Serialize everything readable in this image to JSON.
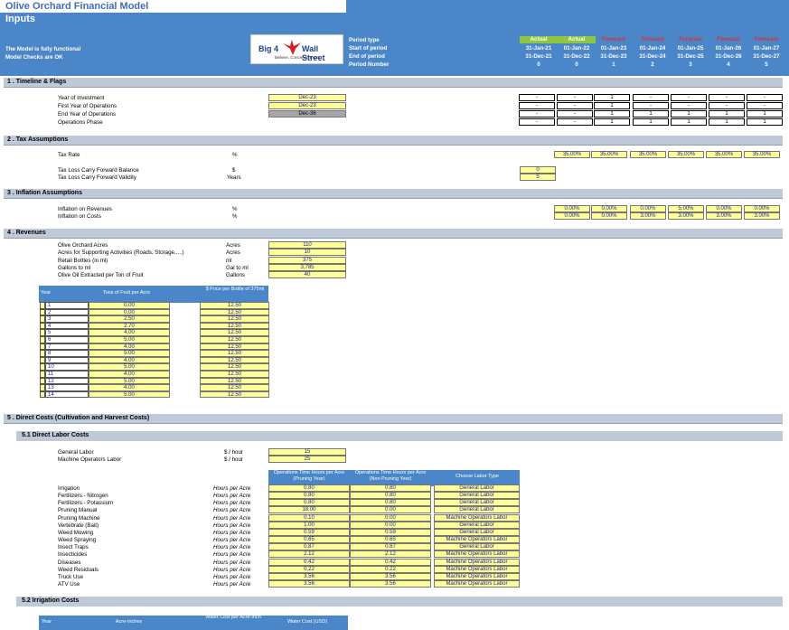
{
  "header": {
    "title": "Olive Orchard Financial Model",
    "subtitle": "Inputs",
    "status1": "The Model is fully functional",
    "status2": "Model Checks are OK",
    "logo_big": "Big 4",
    "logo_wall": "Wall Street",
    "logo_tag": "Believe, Conceive, Excel",
    "labels": [
      "Period type",
      "Start of period",
      "End of period",
      "Period Number"
    ],
    "periods": [
      {
        "type": "Actual",
        "start": "31-Jan-21",
        "end": "31-Dec-21",
        "num": "0"
      },
      {
        "type": "Actual",
        "start": "01-Jan-22",
        "end": "31-Dec-22",
        "num": "0"
      },
      {
        "type": "Forecast",
        "start": "01-Jan-23",
        "end": "31-Dec-23",
        "num": "1"
      },
      {
        "type": "Forecast",
        "start": "01-Jan-24",
        "end": "31-Dec-24",
        "num": "2"
      },
      {
        "type": "Forecast",
        "start": "01-Jan-25",
        "end": "31-Dec-25",
        "num": "3"
      },
      {
        "type": "Forecast",
        "start": "01-Jan-26",
        "end": "31-Dec-26",
        "num": "4"
      },
      {
        "type": "Forecast",
        "start": "01-Jan-27",
        "end": "31-Dec-27",
        "num": "5"
      }
    ]
  },
  "s1": {
    "title": "1 .  Timeline & Flags",
    "rows": [
      {
        "label": "Year of Investment",
        "value": "Dec-23",
        "flags": [
          "-",
          "-",
          "1",
          "-",
          "-",
          "-",
          "-"
        ]
      },
      {
        "label": "First Year of Operations",
        "value": "Dec-23",
        "flags": [
          "-",
          "-",
          "1",
          "-",
          "-",
          "-",
          "-"
        ]
      },
      {
        "label": "End Year of Operations",
        "value": "Dec-36",
        "flags": [
          "-",
          "-",
          "1",
          "1",
          "1",
          "1",
          "1"
        ]
      },
      {
        "label": "Operations Phase",
        "value": "",
        "flags": [
          "-",
          "-",
          "1",
          "1",
          "1",
          "1",
          "1"
        ]
      }
    ]
  },
  "s2": {
    "title": "2 .  Tax Assumptions",
    "tax_label": "Tax Rate",
    "tax_unit": "%",
    "tax_rates": [
      "35.00%",
      "35.00%",
      "35.00%",
      "35.00%",
      "35.00%",
      "35.00%"
    ],
    "tlcf_label": "Tax Loss Carry Forward Balance",
    "tlcf_unit": "$",
    "tlcf_value": "0",
    "tlcv_label": "Tax Loss Carry Forward Validity",
    "tlcv_unit": "Years",
    "tlcv_value": "5"
  },
  "s3": {
    "title": "3 .  Inflation Assumptions",
    "rev_label": "Inflation on Revenues",
    "rev_unit": "%",
    "rev": [
      "0.00%",
      "0.00%",
      "0.00%",
      "5.00%",
      "0.00%",
      "0.00%"
    ],
    "cost_label": "Inflation on Costs",
    "cost_unit": "%",
    "cost": [
      "0.00%",
      "0.00%",
      "3.00%",
      "3.00%",
      "3.00%",
      "3.00%"
    ]
  },
  "s4": {
    "title": "4 .  Revenues",
    "params": [
      {
        "label": "Olive Orchard Acres",
        "unit": "Acres",
        "value": "110"
      },
      {
        "label": "Acres for Supporting Activities (Roads, Storage,....)",
        "unit": "Acres",
        "value": "10"
      },
      {
        "label": "Retail Bottles (in ml)",
        "unit": "ml",
        "value": "375"
      },
      {
        "label": "Gallons to ml",
        "unit": "Gal to ml",
        "value": "3,785"
      },
      {
        "label": "Olive Oil Extracted per Ton of Fruit",
        "unit": "Gallons",
        "value": "40"
      }
    ],
    "table_headers": [
      "Year",
      "Tons of Fruit per Acre",
      "$ Price per Bottle of 375ml"
    ],
    "table": [
      [
        "1",
        "0.00",
        "12.50"
      ],
      [
        "2",
        "0.00",
        "12.50"
      ],
      [
        "3",
        "2.50",
        "12.50"
      ],
      [
        "4",
        "2.70",
        "12.50"
      ],
      [
        "5",
        "4.00",
        "12.50"
      ],
      [
        "6",
        "5.00",
        "12.50"
      ],
      [
        "7",
        "4.00",
        "12.50"
      ],
      [
        "8",
        "5.00",
        "12.50"
      ],
      [
        "9",
        "4.00",
        "12.50"
      ],
      [
        "10",
        "5.00",
        "12.50"
      ],
      [
        "11",
        "4.00",
        "12.50"
      ],
      [
        "12",
        "5.00",
        "12.50"
      ],
      [
        "13",
        "4.00",
        "12.50"
      ],
      [
        "14",
        "5.00",
        "12.50"
      ]
    ]
  },
  "s5": {
    "title": "5 .  Direct Costs (Cultivation and Harvest Costs)",
    "sub1": "5.1    Direct Labor Costs",
    "labor": [
      {
        "label": "General Labor",
        "unit": "$ / hour",
        "value": "15"
      },
      {
        "label": "Machine Operators Labor",
        "unit": "$ / hour",
        "value": "25"
      }
    ],
    "op_headers": [
      "Operations Time Hours per Acre (Pruning Year)",
      "Operations Time Hours per Acre (Non Pruning Year)",
      "Choose Labor Type"
    ],
    "ops": [
      [
        "Irrigation",
        "Hours per Acre",
        "0.80",
        "0.80",
        "General Labor"
      ],
      [
        "Fertilizers - Nitrogen",
        "Hours per Acre",
        "0.80",
        "0.80",
        "General Labor"
      ],
      [
        "Fertilizers - Potassium",
        "Hours per Acre",
        "0.80",
        "0.80",
        "General Labor"
      ],
      [
        "Pruning Manual",
        "Hours per Acre",
        "18.00",
        "0.00",
        "General Labor"
      ],
      [
        "Pruning Machine",
        "Hours per Acre",
        "0.10",
        "0.00",
        "Machine Operators Labor"
      ],
      [
        "Vertebrate (Bait)",
        "Hours per Acre",
        "1.00",
        "0.00",
        "General Labor"
      ],
      [
        "Weed Mowing",
        "Hours per Acre",
        "0.59",
        "0.59",
        "General Labor"
      ],
      [
        "Weed Spraying",
        "Hours per Acre",
        "0.65",
        "0.65",
        "Machine Operators Labor"
      ],
      [
        "Insect Traps",
        "Hours per Acre",
        "0.87",
        "0.87",
        "General Labor"
      ],
      [
        "Insecticides",
        "Hours per Acre",
        "2.12",
        "2.12",
        "Machine Operators Labor"
      ],
      [
        "Diseases",
        "Hours per Acre",
        "0.42",
        "0.42",
        "Machine Operators Labor"
      ],
      [
        "Weed Residuals",
        "Hours per Acre",
        "0.22",
        "0.22",
        "Machine Operators Labor"
      ],
      [
        "Truck Use",
        "Hours per Acre",
        "3.56",
        "3.56",
        "Machine Operators Labor"
      ],
      [
        "ATV Use",
        "Hours per Acre",
        "3.56",
        "3.56",
        "Machine Operators Labor"
      ]
    ],
    "sub2": "5.2    Irrigation Costs",
    "irr_headers": [
      "Year",
      "Acre-Inches",
      "Water Cost per Acre-Inch",
      "Water Cost (USD)"
    ]
  },
  "colors": {
    "header_blue": "#4a86c8",
    "input_yellow": "#ffff99",
    "section_grey": "#bfc9d7",
    "actual_green": "#8ec63f",
    "forecast_red": "#e03030"
  }
}
